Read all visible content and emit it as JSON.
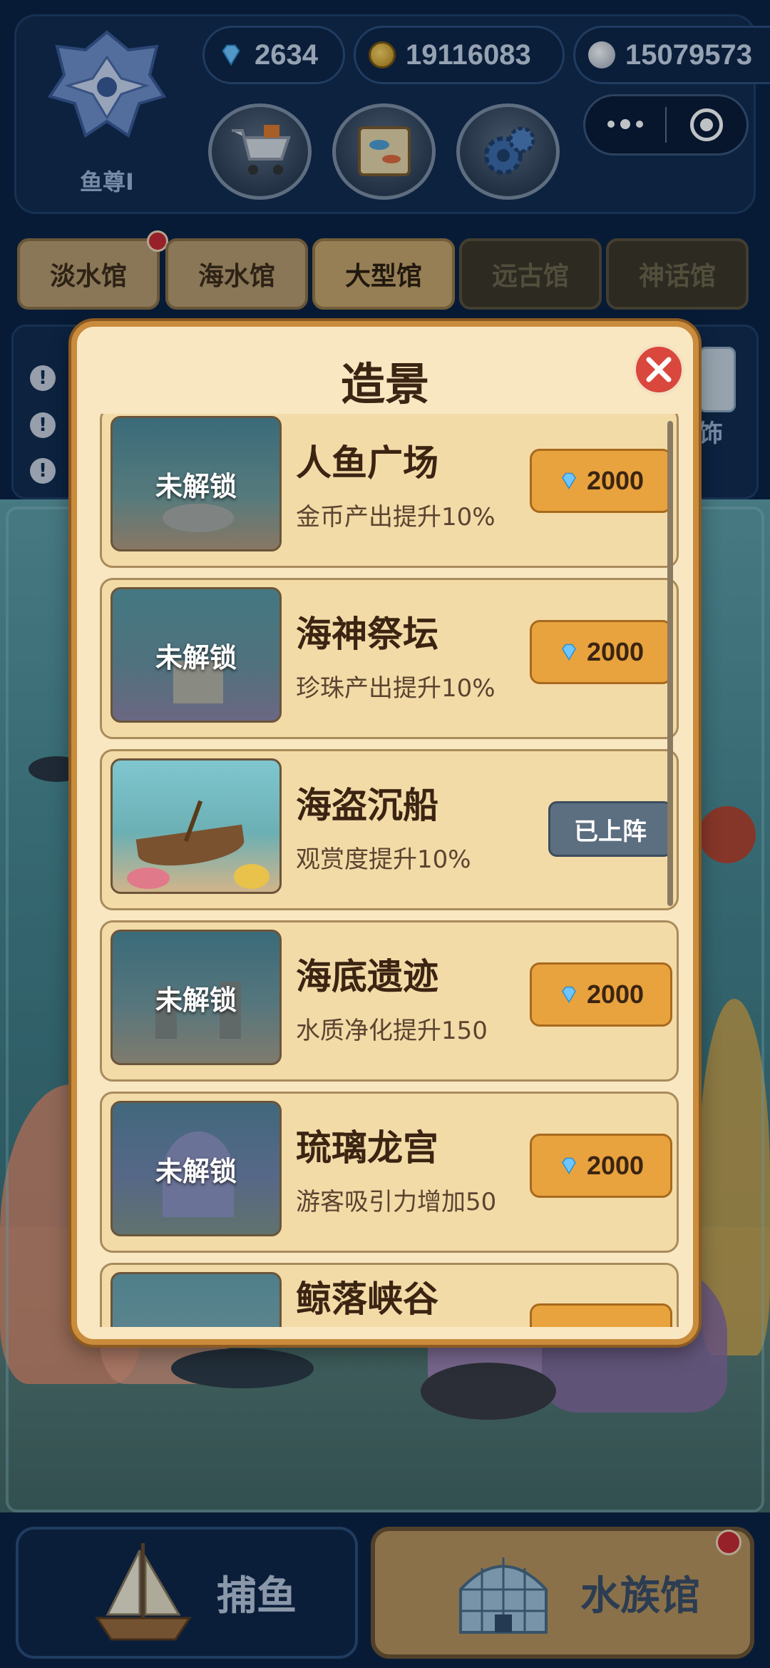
{
  "player": {
    "rank_label": "鱼尊Ⅰ"
  },
  "currencies": [
    {
      "name": "diamond",
      "icon": "diamond-icon",
      "value": "2634",
      "color": "#6ec6ff"
    },
    {
      "name": "gold",
      "icon": "gold-coin-icon",
      "value": "19116083",
      "color": "#e2b33a"
    },
    {
      "name": "pearl",
      "icon": "pearl-icon",
      "value": "15079573",
      "color": "#c8ced8"
    }
  ],
  "toolbar": {
    "shop_icon": "shopping-cart-icon",
    "book_icon": "fish-book-icon",
    "settings_icon": "gear-icon"
  },
  "hall_tabs": [
    {
      "label": "淡水馆",
      "state": "light",
      "badge": true
    },
    {
      "label": "海水馆",
      "state": "light",
      "badge": false
    },
    {
      "label": "大型馆",
      "state": "active",
      "badge": false
    },
    {
      "label": "远古馆",
      "state": "locked",
      "badge": false
    },
    {
      "label": "神话馆",
      "state": "locked",
      "badge": false
    }
  ],
  "side_panel": {
    "decor_label": "饰"
  },
  "modal": {
    "title": "造景",
    "items": [
      {
        "name": "人鱼广场",
        "desc": "金币产出提升10%",
        "locked": true,
        "lock_label": "未解锁",
        "price": "2000",
        "status": "buy"
      },
      {
        "name": "海神祭坛",
        "desc": "珍珠产出提升10%",
        "locked": true,
        "lock_label": "未解锁",
        "price": "2000",
        "status": "buy"
      },
      {
        "name": "海盗沉船",
        "desc": "观赏度提升10%",
        "locked": false,
        "lock_label": "",
        "price": "",
        "status": "deployed",
        "status_label": "已上阵"
      },
      {
        "name": "海底遗迹",
        "desc": "水质净化提升150",
        "locked": true,
        "lock_label": "未解锁",
        "price": "2000",
        "status": "buy"
      },
      {
        "name": "琉璃龙宫",
        "desc": "游客吸引力增加50",
        "locked": true,
        "lock_label": "未解锁",
        "price": "2000",
        "status": "buy"
      },
      {
        "name": "鲸落峡谷",
        "desc": "",
        "locked": true,
        "lock_label": "",
        "price": "",
        "status": "buy"
      }
    ]
  },
  "bottom_nav": {
    "fishing_label": "捕鱼",
    "aquarium_label": "水族馆"
  },
  "colors": {
    "accent_gold": "#e8a33e",
    "panel_navy": "#102a4d",
    "modal_bg": "#f9e7c2",
    "close_red": "#d9473d"
  }
}
